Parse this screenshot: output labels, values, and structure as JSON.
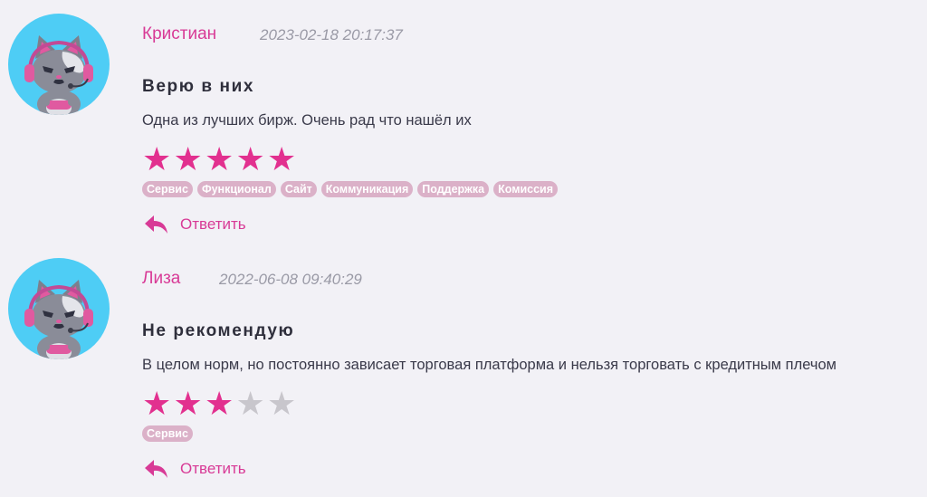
{
  "reviews": [
    {
      "author": "Кристиан",
      "date": "2023-02-18 20:17:37",
      "title": "Верю в них",
      "text": "Одна из лучших бирж. Очень рад что нашёл их",
      "rating": 5,
      "rating_max": 5,
      "tags": [
        "Сервис",
        "Функционал",
        "Сайт",
        "Коммуникация",
        "Поддержка",
        "Комиссия"
      ],
      "reply_label": "Ответить",
      "avatar_icon": "gamer-cat-icon"
    },
    {
      "author": "Лиза",
      "date": "2022-06-08 09:40:29",
      "title": "Не рекомендую",
      "text": "В целом норм, но постоянно зависает торговая платформа и нельзя торговать с кредитным плечом",
      "rating": 3,
      "rating_max": 5,
      "tags": [
        "Сервис"
      ],
      "reply_label": "Ответить",
      "avatar_icon": "gamer-cat-icon"
    }
  ],
  "colors": {
    "background": "#f2f1f6",
    "accent": "#d83a96",
    "star_on": "#e2308f",
    "star_off": "#c8c6cc",
    "tag_bg": "#dbb1c8",
    "avatar_bg": "#4ecdf5"
  }
}
